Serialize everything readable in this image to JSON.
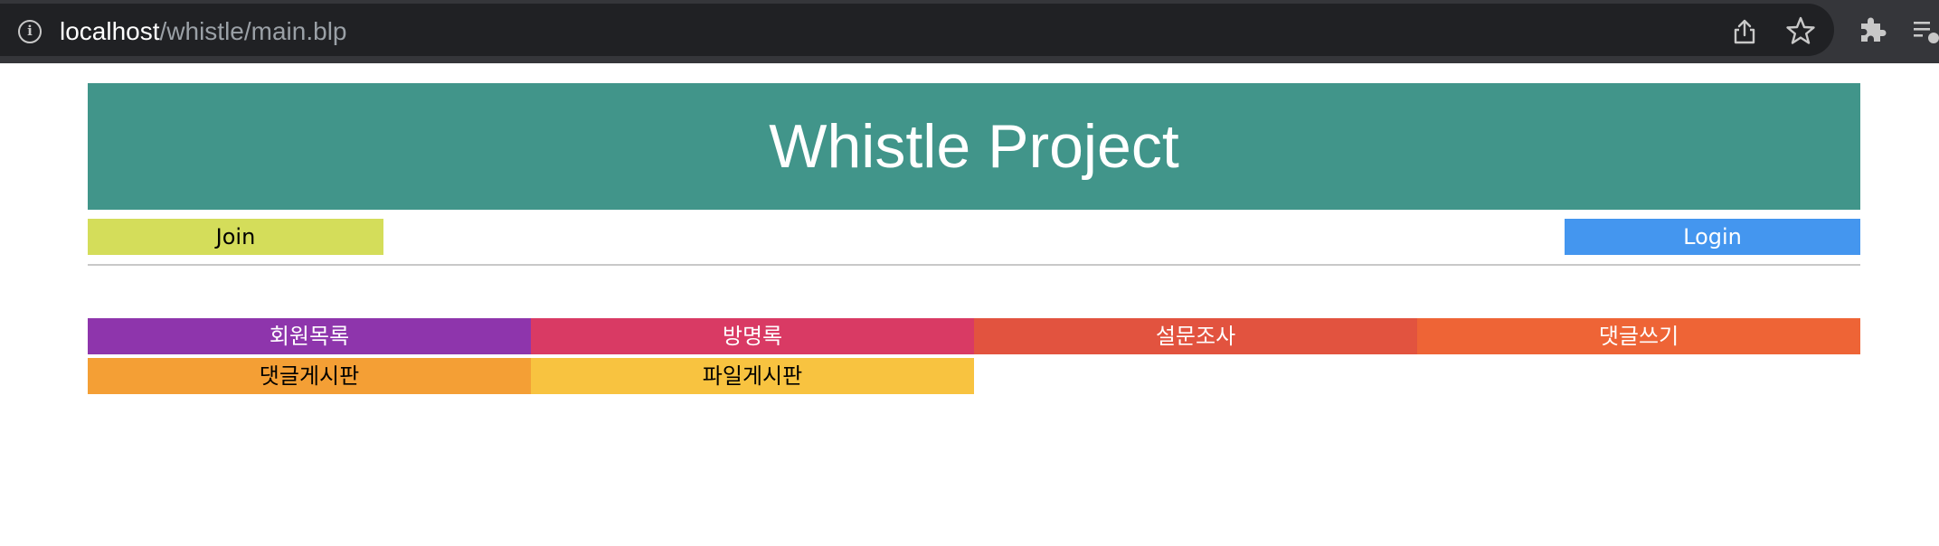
{
  "browser": {
    "url_host": "localhost",
    "url_path": "/whistle/main.blp"
  },
  "header": {
    "title": "Whistle Project"
  },
  "auth": {
    "join_label": "Join",
    "login_label": "Login"
  },
  "menu": {
    "items": [
      {
        "label": "회원목록",
        "bg": "#8e35ac",
        "fg": "#ffffff"
      },
      {
        "label": "방명록",
        "bg": "#d93a64",
        "fg": "#ffffff"
      },
      {
        "label": "설문조사",
        "bg": "#e2533f",
        "fg": "#ffffff"
      },
      {
        "label": "댓글쓰기",
        "bg": "#ee6436",
        "fg": "#ffffff"
      },
      {
        "label": "댓글게시판",
        "bg": "#f49f35",
        "fg": "#000000"
      },
      {
        "label": "파일게시판",
        "bg": "#f8c340",
        "fg": "#000000"
      }
    ]
  },
  "colors": {
    "banner": "#41958a",
    "join": "#d4dd5a",
    "login": "#4496ef"
  }
}
